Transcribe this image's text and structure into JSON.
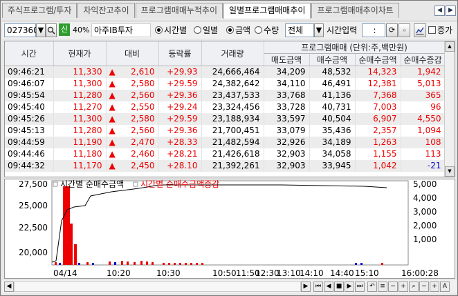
{
  "tabs": [
    "주식프로그램/투자",
    "차익잔고추이",
    "프로그램매매누적추이",
    "일별프로그램매매추이",
    "프로그램매매추이차트"
  ],
  "active_tab": 3,
  "toolbar": {
    "code": "027360",
    "credit_badge": "신",
    "margin": "40%",
    "stock_name": "아주IB투자",
    "radio_time": "시간별",
    "radio_day": "일별",
    "radio_amount": "금액",
    "radio_qty": "수량",
    "select_all": "전체",
    "time_label": "시간입력",
    "time_value": ":",
    "change_label": "증가"
  },
  "table": {
    "headers": [
      "시간",
      "현재가",
      "대비",
      "등락률",
      "거래량"
    ],
    "group_header": "프로그램매매 (단위:주,백만원)",
    "sub_headers": [
      "매도금액",
      "매수금액",
      "순매수금액",
      "순매수증감"
    ],
    "rows": [
      [
        "09:46:21",
        "11,330",
        "2,610",
        "+29.93",
        "24,666,464",
        "34,209",
        "48,532",
        "14,323",
        "1,942"
      ],
      [
        "09:46:07",
        "11,300",
        "2,580",
        "+29.59",
        "24,382,642",
        "34,110",
        "46,491",
        "12,381",
        "5,013"
      ],
      [
        "09:45:54",
        "11,280",
        "2,560",
        "+29.36",
        "23,437,533",
        "33,768",
        "41,136",
        "7,368",
        "365"
      ],
      [
        "09:45:40",
        "11,270",
        "2,550",
        "+29.24",
        "23,324,456",
        "33,728",
        "40,731",
        "7,003",
        "96"
      ],
      [
        "09:45:26",
        "11,300",
        "2,580",
        "+29.59",
        "23,188,934",
        "33,597",
        "40,504",
        "6,907",
        "4,550"
      ],
      [
        "09:45:13",
        "11,280",
        "2,560",
        "+29.36",
        "21,700,451",
        "33,079",
        "35,436",
        "2,357",
        "1,094"
      ],
      [
        "09:44:59",
        "11,190",
        "2,470",
        "+28.33",
        "21,482,594",
        "32,926",
        "34,189",
        "1,263",
        "108"
      ],
      [
        "09:44:46",
        "11,180",
        "2,460",
        "+28.21",
        "21,426,618",
        "32,903",
        "34,058",
        "1,155",
        "113"
      ],
      [
        "09:44:32",
        "11,170",
        "2,450",
        "+28.10",
        "21,392,261",
        "32,903",
        "33,945",
        "1,042",
        "-21"
      ]
    ]
  },
  "chart_data": {
    "type": "line",
    "legend": [
      "시간별 순매수금액",
      "시간별 순매수금액증감"
    ],
    "left_axis": [
      "27,500",
      "25,000",
      "22,500",
      "20,000"
    ],
    "right_axis": [
      "5,000",
      "4,000",
      "3,000",
      "2,000",
      "1,000"
    ],
    "x_labels": [
      "04/14",
      "10:20",
      "10:30",
      "10:50",
      "11:50",
      "12:30",
      "13:10",
      "14:10",
      "14:40",
      "15:10",
      "16:00:28"
    ]
  },
  "colors": {
    "up": "#e00000",
    "down": "#0000cc",
    "bar": "#e00000"
  }
}
